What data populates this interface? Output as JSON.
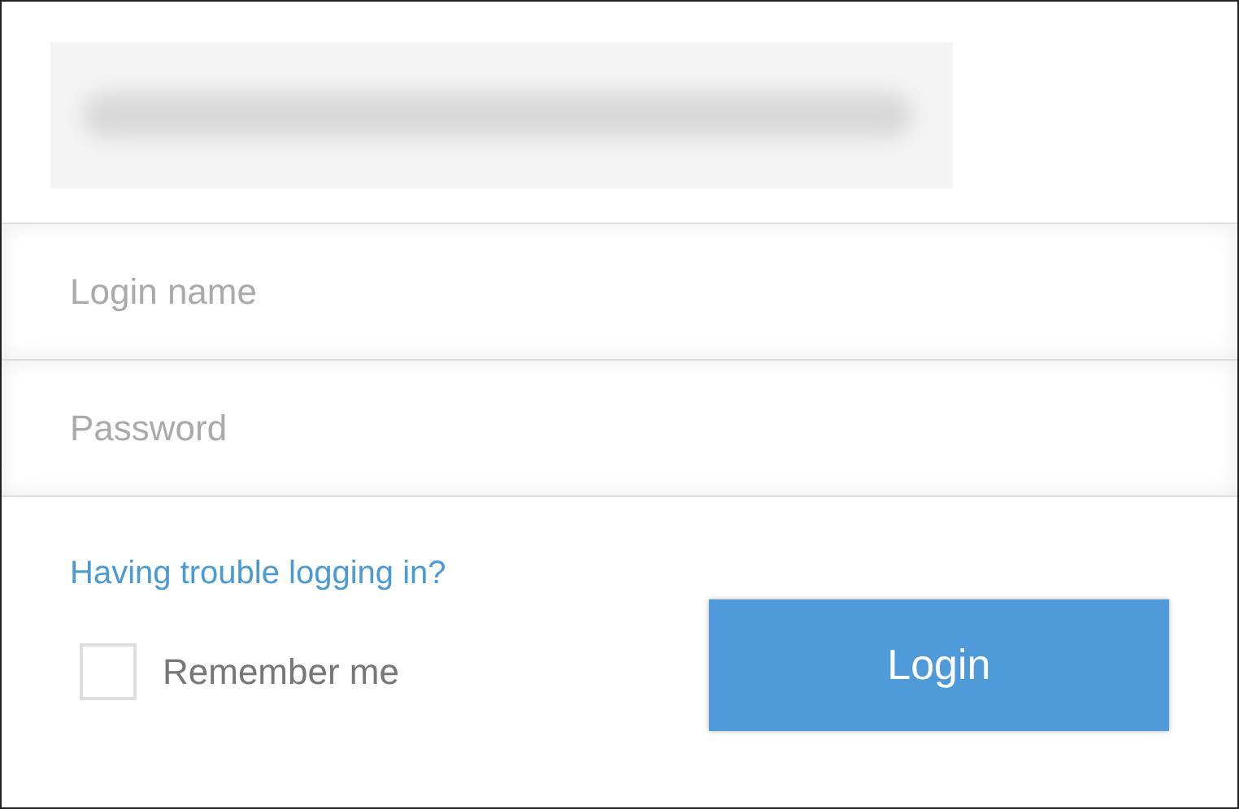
{
  "fields": [
    {
      "placeholder": "Login name"
    },
    {
      "placeholder": "Password"
    }
  ],
  "help_link": "Having trouble logging in?",
  "remember": {
    "label": "Remember me",
    "checked": false
  },
  "login_button": "Login"
}
